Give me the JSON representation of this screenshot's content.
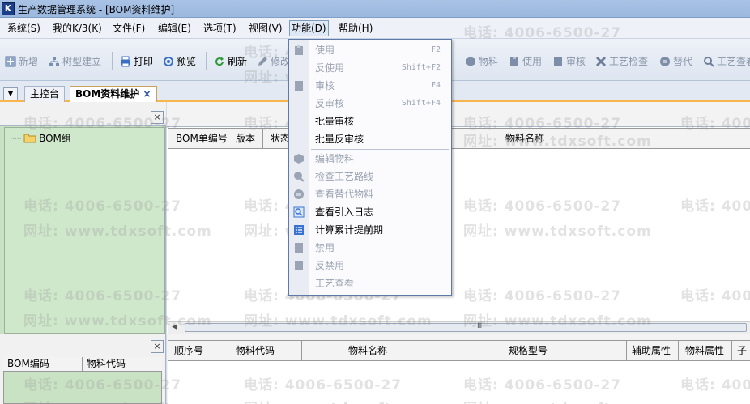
{
  "window": {
    "title": "生产数据管理系统 - [BOM资料维护]",
    "icon_label": "K"
  },
  "menubar": {
    "items": [
      {
        "label": "系统(S)"
      },
      {
        "label": "我的K/3(K)"
      },
      {
        "label": "文件(F)"
      },
      {
        "label": "编辑(E)"
      },
      {
        "label": "选项(T)"
      },
      {
        "label": "视图(V)"
      },
      {
        "label": "功能(D)"
      },
      {
        "label": "帮助(H)"
      }
    ]
  },
  "toolbar": {
    "buttons": [
      {
        "label": "新增",
        "icon": "plus-icon"
      },
      {
        "label": "树型建立",
        "icon": "tree-icon"
      },
      {
        "label": "打印",
        "icon": "printer-icon"
      },
      {
        "label": "预览",
        "icon": "preview-icon"
      },
      {
        "label": "刷新",
        "icon": "refresh-icon"
      },
      {
        "label": "修改",
        "icon": "edit-icon"
      },
      {
        "label": "物料",
        "icon": "cube-icon"
      },
      {
        "label": "使用",
        "icon": "clipboard-icon"
      },
      {
        "label": "审核",
        "icon": "book-icon"
      },
      {
        "label": "工艺检查",
        "icon": "tools-icon"
      },
      {
        "label": "替代",
        "icon": "swap-icon"
      },
      {
        "label": "工艺查看",
        "icon": "search-icon"
      }
    ]
  },
  "tabs": [
    {
      "label": "主控台"
    },
    {
      "label": "BOM资料维护",
      "close": "×"
    }
  ],
  "tree": {
    "root_label": "BOM组"
  },
  "grid1": {
    "columns": [
      "BOM单编号",
      "版本",
      "状态",
      "物料名称"
    ]
  },
  "scroll": {
    "grip": "Ⅲ"
  },
  "bottom_left": {
    "columns": [
      "BOM编码",
      "物料代码"
    ]
  },
  "grid2": {
    "columns": [
      "顺序号",
      "物料代码",
      "物料名称",
      "规格型号",
      "辅助属性",
      "物料属性",
      "子"
    ]
  },
  "panel_close": "×",
  "watermark": {
    "phone": "电话: 4006-6500-27",
    "site": "网址: www.tdxsoft.com"
  },
  "function_menu": {
    "items": [
      {
        "label": "使用",
        "shortcut": "F2",
        "enabled": false,
        "icon": "clipboard-icon"
      },
      {
        "label": "反使用",
        "shortcut": "Shift+F2",
        "enabled": false,
        "icon": ""
      },
      {
        "label": "审核",
        "shortcut": "F4",
        "enabled": false,
        "icon": "book-icon"
      },
      {
        "label": "反审核",
        "shortcut": "Shift+F4",
        "enabled": false,
        "icon": ""
      },
      {
        "label": "批量审核",
        "shortcut": "",
        "enabled": true,
        "icon": ""
      },
      {
        "label": "批量反审核",
        "shortcut": "",
        "enabled": true,
        "icon": ""
      },
      {
        "label": "编辑物料",
        "shortcut": "",
        "enabled": false,
        "icon": "cube-icon"
      },
      {
        "label": "检查工艺路线",
        "shortcut": "",
        "enabled": false,
        "icon": "magnifier-icon"
      },
      {
        "label": "查看替代物料",
        "shortcut": "",
        "enabled": false,
        "icon": "swap-icon"
      },
      {
        "label": "查看引入日志",
        "shortcut": "",
        "enabled": true,
        "icon": "log-search-icon"
      },
      {
        "label": "计算累计提前期",
        "shortcut": "",
        "enabled": true,
        "icon": "calculator-icon"
      },
      {
        "label": "禁用",
        "shortcut": "",
        "enabled": false,
        "icon": "page-icon"
      },
      {
        "label": "反禁用",
        "shortcut": "",
        "enabled": false,
        "icon": "page-icon"
      },
      {
        "label": "工艺查看",
        "shortcut": "",
        "enabled": false,
        "icon": ""
      }
    ]
  },
  "colors": {
    "accent": "#f6b64c",
    "tree_bg": "#c9e2c4",
    "menu_border": "#5f7aa8"
  }
}
